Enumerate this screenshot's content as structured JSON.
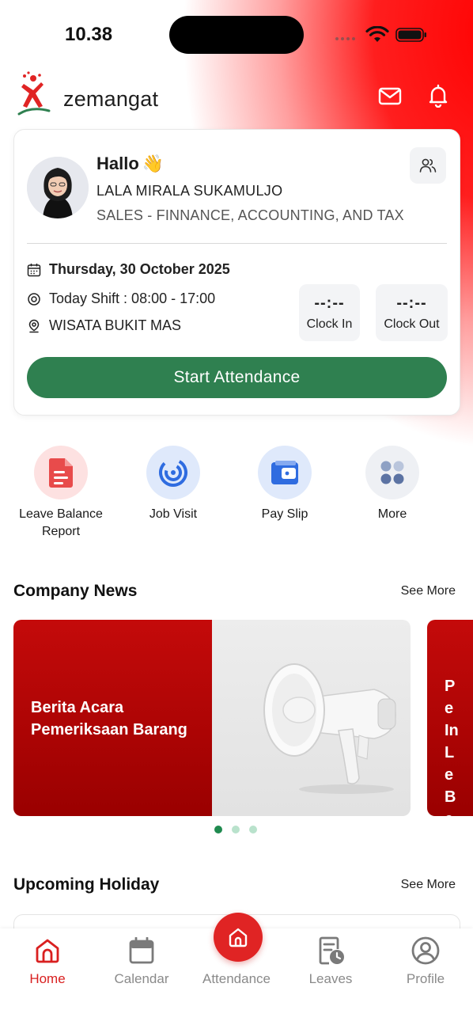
{
  "status_bar": {
    "time": "10.38"
  },
  "brand": {
    "name": "zemangat"
  },
  "colors": {
    "accent": "#e02424",
    "primary_button": "#2f8050",
    "news_red": "#c40a0a"
  },
  "profile_card": {
    "greeting": "Hallo",
    "greeting_emoji": "👋",
    "name": "LALA MIRALA SUKAMULJO",
    "department": "SALES - FINNANCE, ACCOUNTING, AND TAX",
    "date": "Thursday, 30 October 2025",
    "shift": "Today Shift : 08:00 - 17:00",
    "location": "WISATA BUKIT MAS",
    "clock_in": {
      "value": "--:--",
      "label": "Clock In"
    },
    "clock_out": {
      "value": "--:--",
      "label": "Clock Out"
    },
    "start_button": "Start Attendance"
  },
  "quick_menu": [
    {
      "label": "Leave Balance Report",
      "icon": "document-icon"
    },
    {
      "label": "Job Visit",
      "icon": "radar-icon"
    },
    {
      "label": "Pay Slip",
      "icon": "wallet-icon"
    },
    {
      "label": "More",
      "icon": "grid-icon"
    }
  ],
  "company_news": {
    "title": "Company News",
    "see_more": "See More",
    "items": [
      {
        "title": "Berita Acara Pemeriksaan Barang"
      },
      {
        "title": "Pe In Le Be"
      }
    ]
  },
  "upcoming_holiday": {
    "title": "Upcoming Holiday",
    "see_more": "See More"
  },
  "bottom_nav": [
    {
      "label": "Home",
      "icon": "home-icon",
      "active": true
    },
    {
      "label": "Calendar",
      "icon": "calendar-icon",
      "active": false
    },
    {
      "label": "Attendance",
      "icon": "attendance-icon",
      "active": false
    },
    {
      "label": "Leaves",
      "icon": "leaves-icon",
      "active": false
    },
    {
      "label": "Profile",
      "icon": "profile-icon",
      "active": false
    }
  ]
}
